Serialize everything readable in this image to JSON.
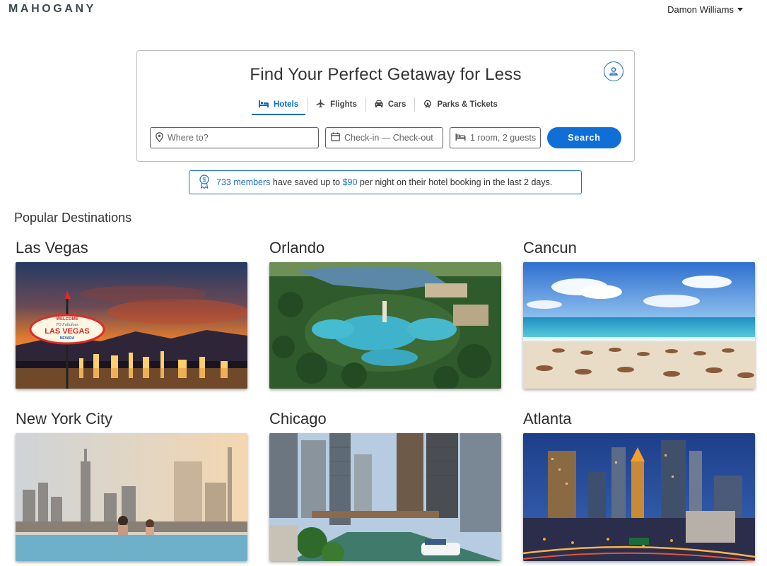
{
  "header": {
    "logo": "MAHOGANY",
    "user_name": "Damon Williams"
  },
  "search": {
    "title": "Find Your Perfect Getaway for Less",
    "tabs": [
      {
        "label": "Hotels",
        "icon": "bed-icon",
        "active": true
      },
      {
        "label": "Flights",
        "icon": "plane-icon",
        "active": false
      },
      {
        "label": "Cars",
        "icon": "car-icon",
        "active": false
      },
      {
        "label": "Parks & Tickets",
        "icon": "ferris-wheel-icon",
        "active": false
      }
    ],
    "destination_placeholder": "Where to?",
    "dates_placeholder": "Check-in — Check-out",
    "guests_value": "1 room, 2 guests",
    "search_label": "Search"
  },
  "savings": {
    "members": "733 members",
    "text_mid": " have saved up to ",
    "amount": "$90",
    "text_end": " per night on their hotel booking in the last 2 days."
  },
  "popular": {
    "heading": "Popular Destinations",
    "destinations": [
      {
        "name": "Las Vegas"
      },
      {
        "name": "Orlando"
      },
      {
        "name": "Cancun"
      },
      {
        "name": "New York City"
      },
      {
        "name": "Chicago"
      },
      {
        "name": "Atlanta"
      }
    ],
    "vegas_sign": {
      "line1": "WELCOME",
      "line2": "TO Fabulous",
      "line3": "LAS VEGAS",
      "line4": "NEVADA"
    }
  },
  "colors": {
    "accent": "#0f6fd6",
    "logo": "#3b4a4d",
    "border": "#bdbdbd"
  }
}
